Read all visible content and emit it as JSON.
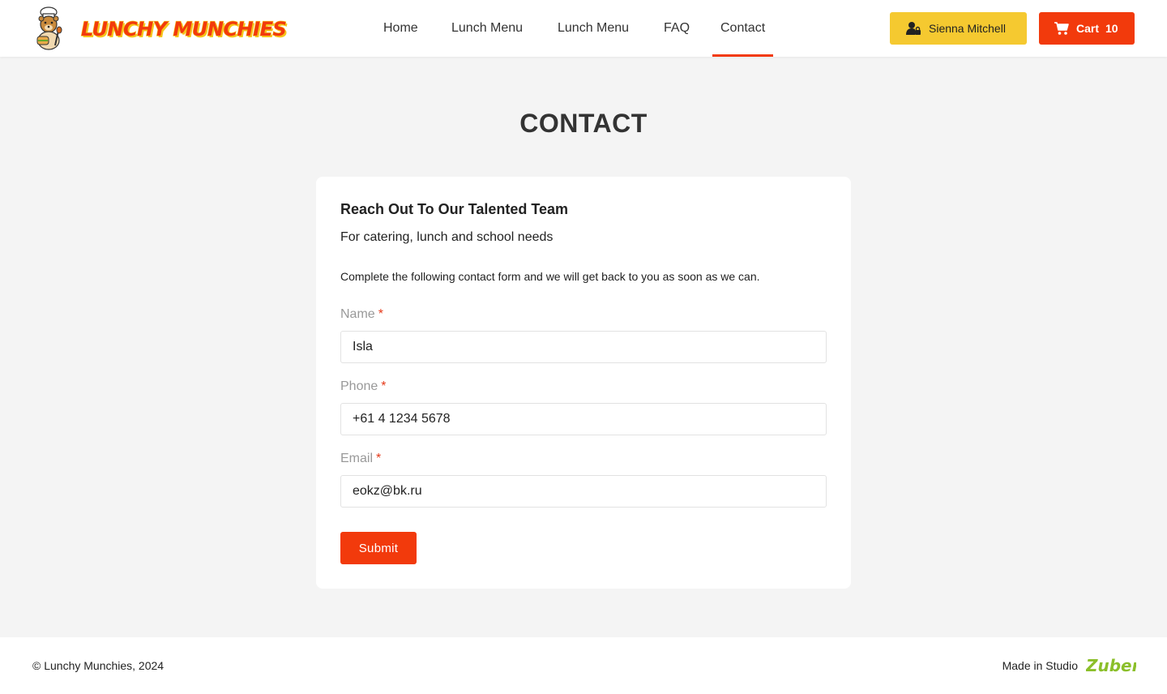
{
  "header": {
    "brand": "LUNCHY MUNCHIES",
    "nav": [
      {
        "label": "Home",
        "active": false
      },
      {
        "label": "Lunch Menu",
        "active": false
      },
      {
        "label": "Lunch Menu",
        "active": false
      },
      {
        "label": "FAQ",
        "active": false
      },
      {
        "label": "Contact",
        "active": true
      }
    ],
    "user_name": "Sienna Mitchell",
    "cart_label": "Cart",
    "cart_count": "10"
  },
  "page": {
    "title": "CONTACT"
  },
  "form": {
    "heading": "Reach Out To Our Talented Team",
    "subheading": "For catering, lunch and school needs",
    "description": "Complete the following contact form and we will get back to you as soon as we can.",
    "fields": [
      {
        "label": "Name",
        "required": "*",
        "value": "Isla"
      },
      {
        "label": "Phone",
        "required": "*",
        "value": "+61 4 1234 5678"
      },
      {
        "label": "Email",
        "required": "*",
        "value": "eokz@bk.ru"
      }
    ],
    "submit_label": "Submit"
  },
  "footer": {
    "copyright": "© Lunchy Munchies, 2024",
    "made_in": "Made in Studio",
    "studio_brand": "Zuber"
  },
  "colors": {
    "accent_red": "#f23a0c",
    "accent_yellow": "#f5c930",
    "studio_green": "#8bbf2a",
    "background": "#f4f4f4"
  },
  "icons": {
    "user": "user-lock-icon",
    "cart": "cart-icon",
    "mascot": "chef-bear-mascot"
  }
}
